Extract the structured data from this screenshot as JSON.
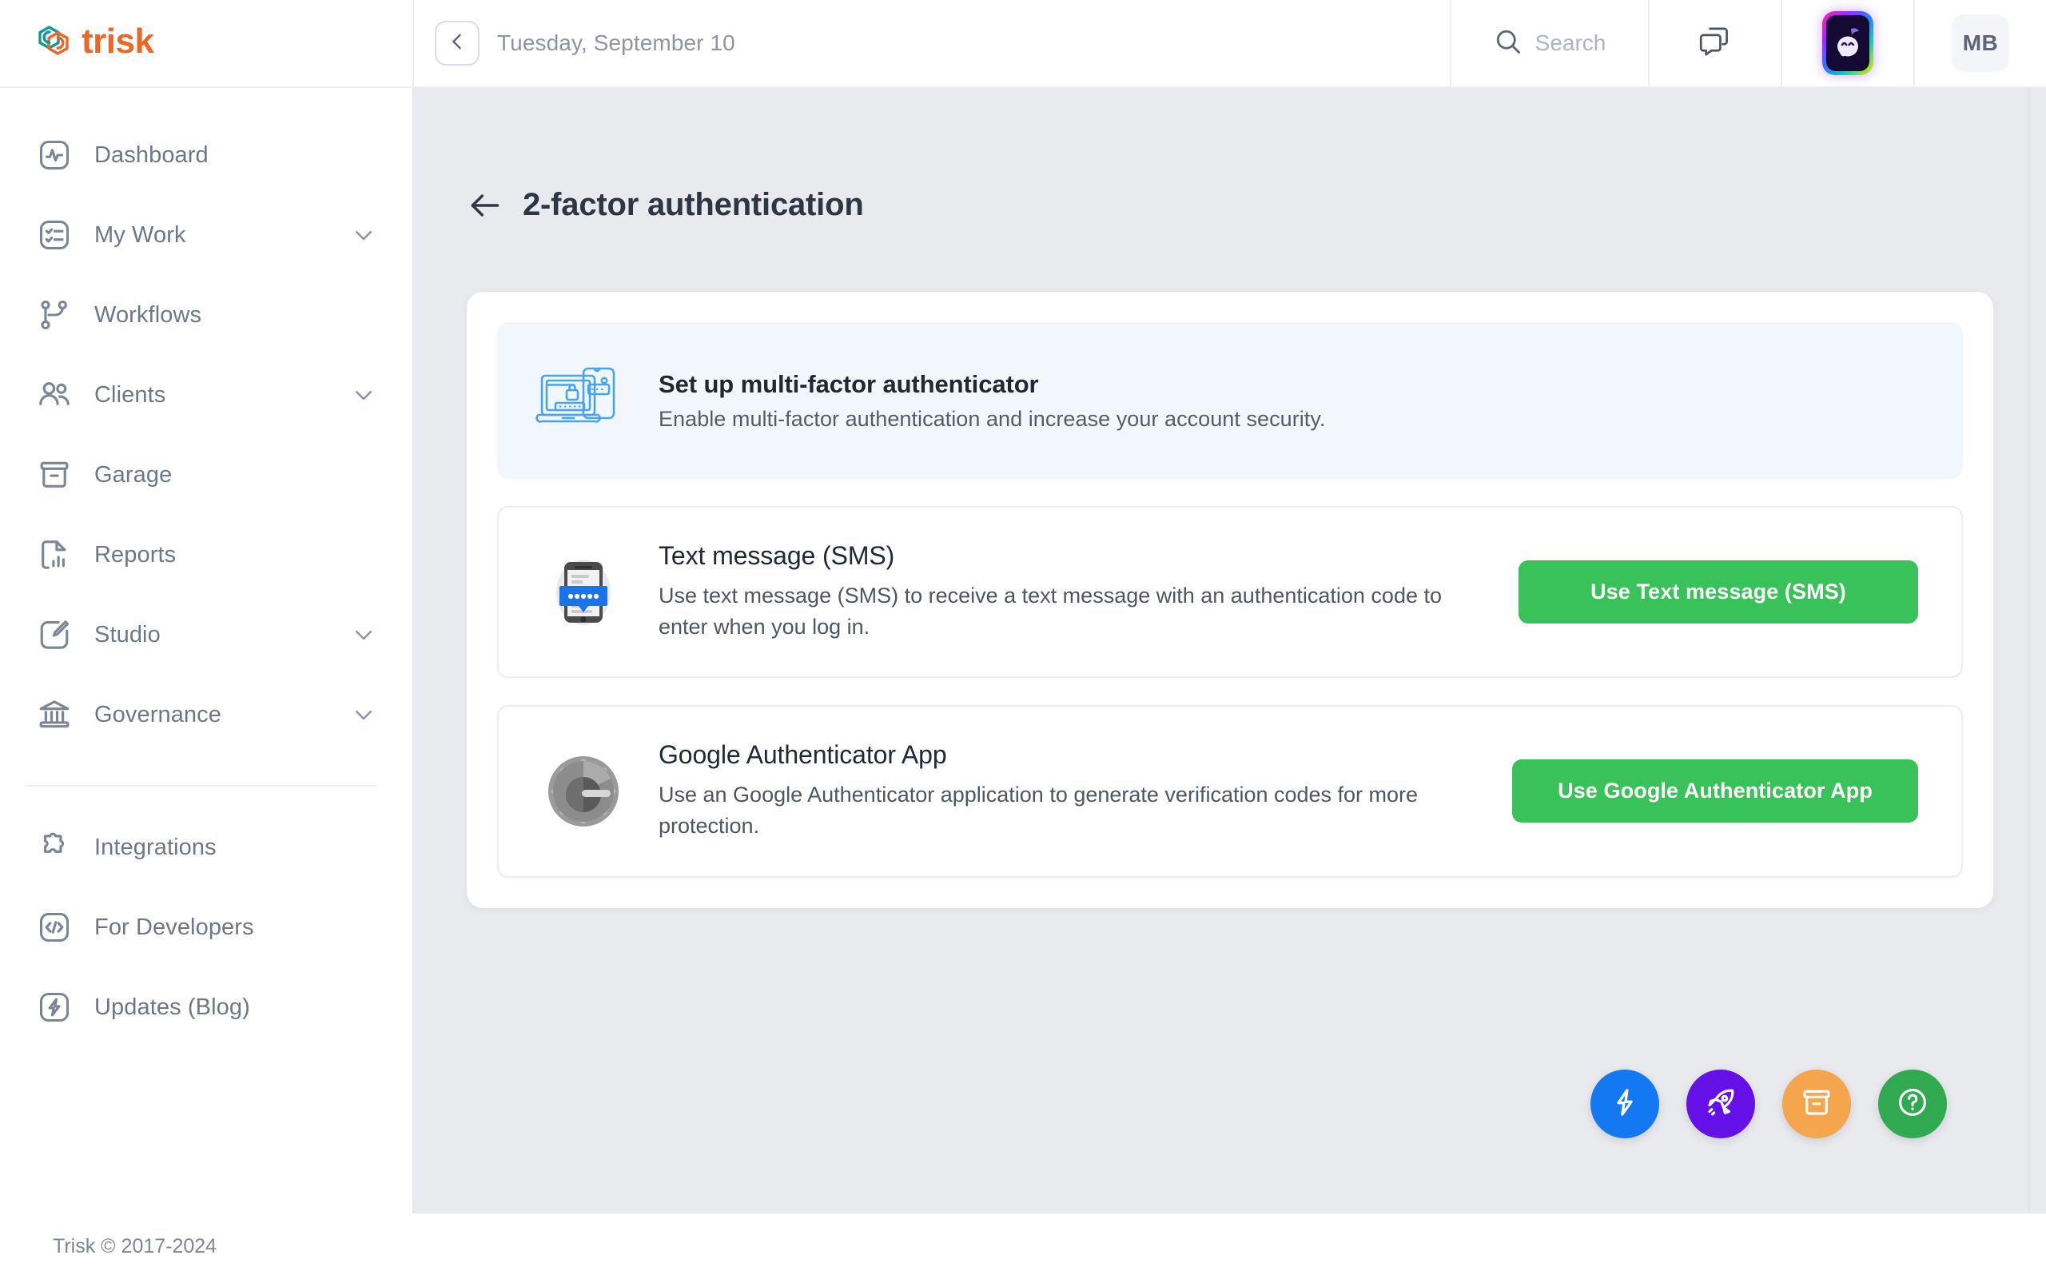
{
  "brand": {
    "name": "trisk",
    "logo_icon": "trisk-hexagon-logo",
    "teal": "#0f9b94",
    "orange": "#ec6628"
  },
  "topbar": {
    "collapse_icon": "chevron-left-icon",
    "date": "Tuesday, September 10",
    "search": {
      "icon": "search-icon",
      "placeholder": "Search"
    },
    "chat": {
      "icon": "chat-bubbles-icon"
    },
    "assistant": {
      "icon": "ai-assistant-avatar-icon"
    },
    "user": {
      "initials": "MB"
    }
  },
  "sidebar": {
    "primary_items": [
      {
        "label": "Dashboard",
        "icon": "activity-pulse-icon",
        "expandable": false
      },
      {
        "label": "My Work",
        "icon": "checklist-icon",
        "expandable": true,
        "chevron": "chevron-down-icon"
      },
      {
        "label": "Workflows",
        "icon": "workflow-branch-icon",
        "expandable": false
      },
      {
        "label": "Clients",
        "icon": "users-icon",
        "expandable": true,
        "chevron": "chevron-down-icon"
      },
      {
        "label": "Garage",
        "icon": "archive-box-icon",
        "expandable": false
      },
      {
        "label": "Reports",
        "icon": "document-chart-icon",
        "expandable": false
      },
      {
        "label": "Studio",
        "icon": "paintbrush-icon",
        "expandable": true,
        "chevron": "chevron-down-icon"
      },
      {
        "label": "Governance",
        "icon": "bank-columns-icon",
        "expandable": true,
        "chevron": "chevron-down-icon"
      }
    ],
    "secondary_items": [
      {
        "label": "Integrations",
        "icon": "puzzle-piece-icon"
      },
      {
        "label": "For Developers",
        "icon": "code-brackets-icon"
      },
      {
        "label": "Updates (Blog)",
        "icon": "lightning-bolt-icon"
      }
    ]
  },
  "page": {
    "back_icon": "arrow-left-icon",
    "title": "2-factor authentication"
  },
  "banner": {
    "illustration_icon": "laptop-phone-lock-illustration",
    "title": "Set up multi-factor authenticator",
    "subtitle": "Enable multi-factor authentication and increase your account security.",
    "background": "#f2f7fe"
  },
  "methods": [
    {
      "id": "sms",
      "illustration_icon": "phone-sms-bubble-illustration",
      "title": "Text message (SMS)",
      "description": "Use text message (SMS) to receive a text message with an authentication code to enter when you log in.",
      "button_label": "Use Text message (SMS)",
      "button_color": "#39c25a"
    },
    {
      "id": "google-authenticator",
      "illustration_icon": "google-authenticator-vault-illustration",
      "title": "Google Authenticator App",
      "description": "Use an Google Authenticator application to generate verification codes for more protection.",
      "button_label": "Use Google Authenticator App",
      "button_color": "#39c25a"
    }
  ],
  "fabs": [
    {
      "name": "quick-actions",
      "icon": "lightning-bolt-icon",
      "color": "#1279f2"
    },
    {
      "name": "whats-new",
      "icon": "rocket-icon",
      "color": "#6610e8"
    },
    {
      "name": "archive",
      "icon": "archive-box-icon",
      "color": "#f5a council"
    },
    {
      "name": "help",
      "icon": "question-mark-circle-icon",
      "color": "#30a951"
    }
  ],
  "fab_colors": [
    "#1279f2",
    "#6610e8",
    "#f5a54b",
    "#30a951"
  ],
  "footer": {
    "copyright": "Trisk © 2017-2024"
  }
}
